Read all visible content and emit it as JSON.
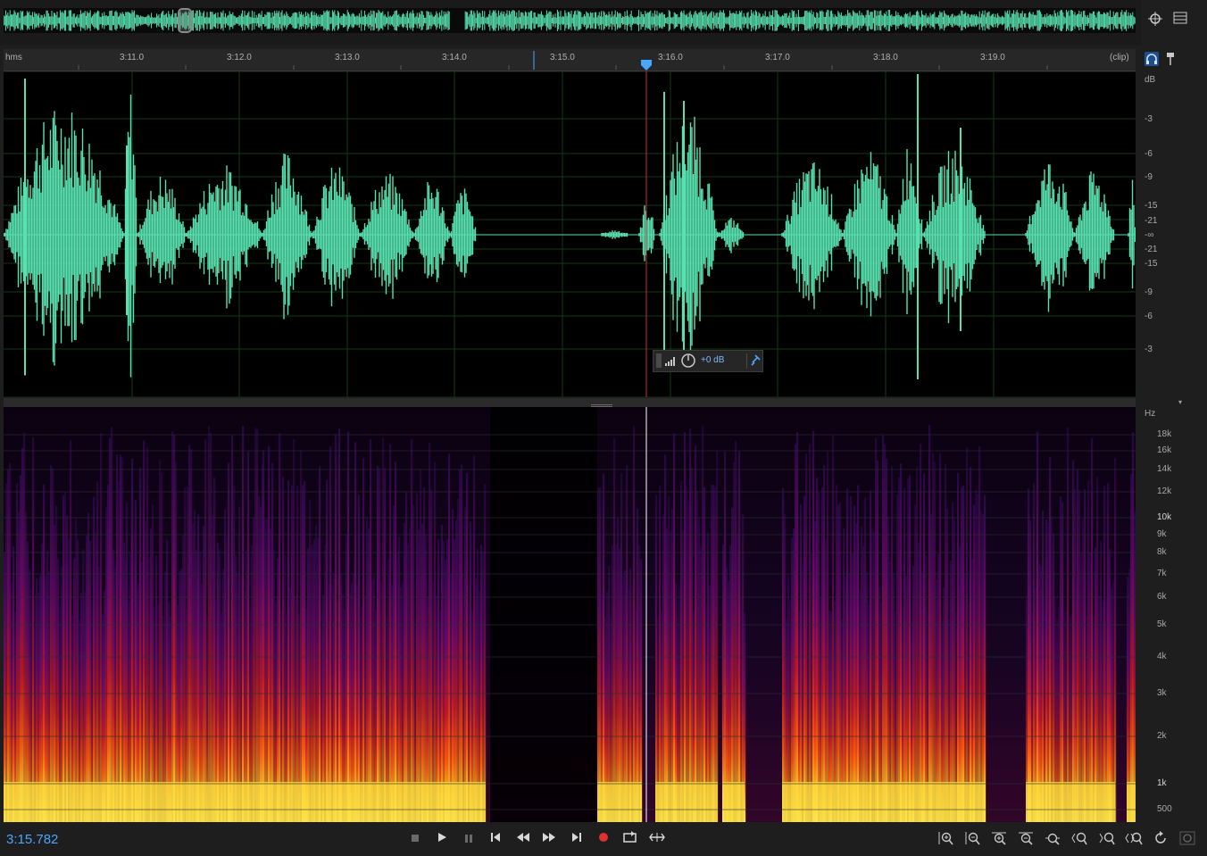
{
  "colors": {
    "waveform": "#58e0b0",
    "playhead_marker": "#4aa6ff",
    "record": "#e03030",
    "time_display": "#4aa6ff"
  },
  "ruler": {
    "unit_label": "hms",
    "clip_label": "(clip)",
    "ticks": [
      "3:11.0",
      "3:12.0",
      "3:13.0",
      "3:14.0",
      "3:15.0",
      "3:16.0",
      "3:17.0",
      "3:18.0",
      "3:19.0"
    ]
  },
  "db_scale": {
    "unit": "dB",
    "labels": [
      "-3",
      "-6",
      "-9",
      "-15",
      "-21",
      "-∞",
      "-21",
      "-15",
      "-9",
      "-6",
      "-3"
    ]
  },
  "hz_scale": {
    "unit": "Hz",
    "labels": [
      "18k",
      "16k",
      "14k",
      "12k",
      "10k",
      "9k",
      "8k",
      "7k",
      "6k",
      "5k",
      "4k",
      "3k",
      "2k",
      "1k",
      "500"
    ]
  },
  "hud": {
    "gain": "+0 dB",
    "icons": [
      "level-bars-icon",
      "volume-knob-icon",
      "pin-icon"
    ]
  },
  "transport": {
    "current_time": "3:15.782",
    "buttons": [
      "stop",
      "play",
      "pause",
      "go-to-start",
      "rewind",
      "fast-forward",
      "go-to-end",
      "record",
      "loop",
      "skip-selection"
    ]
  },
  "zoom_tools": [
    "zoom-in-amplitude",
    "zoom-out-amplitude",
    "zoom-in-time",
    "zoom-out-time",
    "zoom-full",
    "zoom-in-at-start",
    "zoom-in-at-end",
    "zoom-selection",
    "rotate-scroll",
    "spectral-zoom"
  ],
  "top_icons": [
    "zoom-navigator-icon",
    "panel-menu-icon"
  ],
  "ruler_icons": [
    "headphones-icon",
    "marker-pin-icon"
  ]
}
